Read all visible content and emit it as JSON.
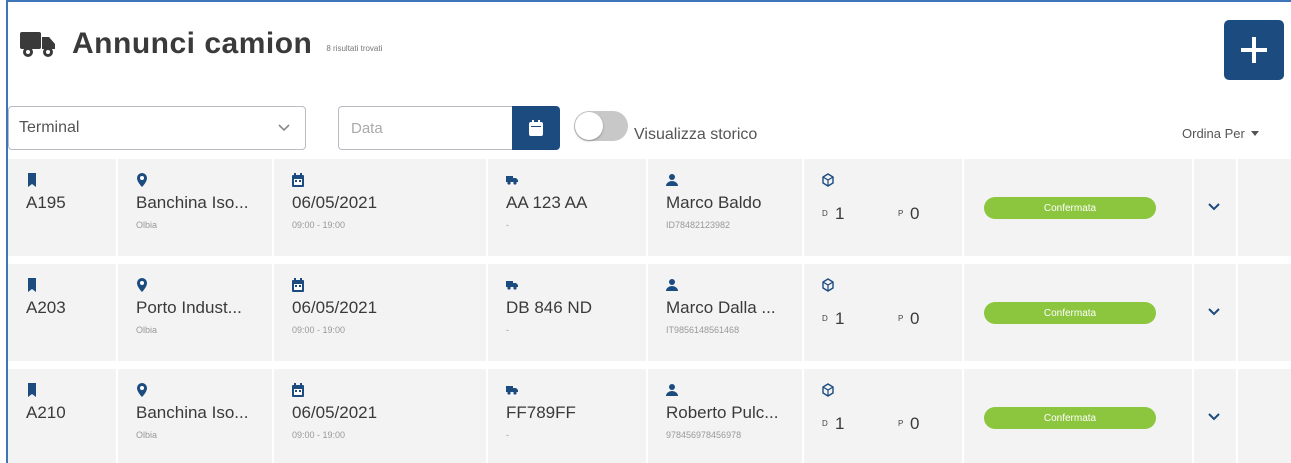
{
  "header": {
    "title": "Annunci camion",
    "results_note": "8 risultati trovati",
    "title_icon": "truck-icon",
    "add_icon": "plus-icon"
  },
  "filters": {
    "terminal_label": "Terminal",
    "date_placeholder": "Data",
    "toggle_label": "Visualizza storico",
    "toggle_on": false,
    "sort_label": "Ordina Per"
  },
  "colors": {
    "accent": "#1c4b7f",
    "status_green": "#8cc63f",
    "row_bg": "#f3f3f3"
  },
  "rows": [
    {
      "code": "A195",
      "location": "Banchina Iso...",
      "city": "Olbia",
      "date": "06/05/2021",
      "time": "09:00 - 19:00",
      "plate": "AA 123 AA",
      "plate_sub": "-",
      "driver": "Marco Baldo",
      "driver_id": "ID78482123982",
      "d_label": "D",
      "d_value": "1",
      "p_label": "P",
      "p_value": "0",
      "status": "Confermata"
    },
    {
      "code": "A203",
      "location": "Porto Indust...",
      "city": "Olbia",
      "date": "06/05/2021",
      "time": "09:00 - 19:00",
      "plate": "DB 846 ND",
      "plate_sub": "-",
      "driver": "Marco Dalla ...",
      "driver_id": "IT9856148561468",
      "d_label": "D",
      "d_value": "1",
      "p_label": "P",
      "p_value": "0",
      "status": "Confermata"
    },
    {
      "code": "A210",
      "location": "Banchina Iso...",
      "city": "Olbia",
      "date": "06/05/2021",
      "time": "09:00 - 19:00",
      "plate": "FF789FF",
      "plate_sub": "-",
      "driver": "Roberto Pulc...",
      "driver_id": "978456978456978",
      "d_label": "D",
      "d_value": "1",
      "p_label": "P",
      "p_value": "0",
      "status": "Confermata"
    }
  ]
}
